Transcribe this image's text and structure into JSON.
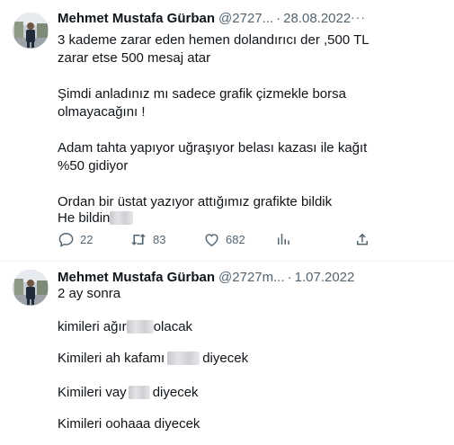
{
  "tweets": [
    {
      "author_name": "Mehmet Mustafa Gürban",
      "handle": "@2727...",
      "date": "28.08.2022",
      "more_label": "···",
      "paragraphs": [
        "3 kademe zarar eden hemen dolandırıcı der ,500 TL",
        "zarar etse 500 mesaj atar",
        "Şimdi anladınız mı sadece grafik çizmekle borsa",
        "olmayacağını !",
        "Adam tahta yapıyor uğraşıyor belası kazası ile kağıt",
        "%50 gidiyor",
        "Ordan bir üstat yazıyor attığımız grafikte bildik",
        "He bildin"
      ],
      "actions": {
        "replies": "22",
        "retweets": "83",
        "likes": "682"
      }
    },
    {
      "author_name": "Mehmet Mustafa Gürban",
      "handle": "@2727m...",
      "date": "1.07.2022",
      "lines": {
        "l1": "2 ay sonra",
        "l2a": "kimileri ağır",
        "l2b": "olacak",
        "l3a": "Kimileri ah kafamı",
        "l3b": "diyecek",
        "l4a": "Kimileri vay",
        "l4b": "diyecek",
        "l5": "Kimileri oohaaa diyecek"
      }
    }
  ]
}
